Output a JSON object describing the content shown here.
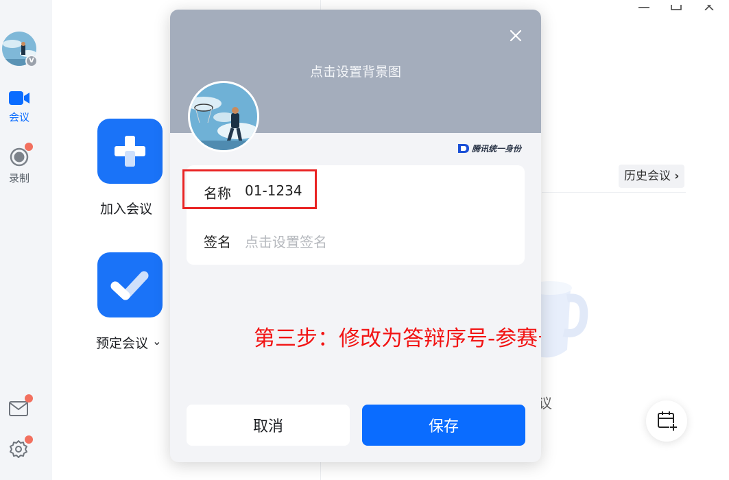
{
  "sidebar": {
    "avatar_badge": "V",
    "items": [
      {
        "label": "会议",
        "icon": "video-camera-icon",
        "active": true
      },
      {
        "label": "录制",
        "icon": "record-icon",
        "active": false
      }
    ],
    "bottom_icons": [
      "mail-icon",
      "gear-icon"
    ]
  },
  "main": {
    "join_label": "加入会议",
    "schedule_label": "预定会议",
    "dropdown_glyph": "⌄"
  },
  "right": {
    "history_label": "历史会议",
    "history_chevron": "›",
    "empty_partial": "议"
  },
  "dialog": {
    "set_background": "点击设置背景图",
    "tencent_id": "腾讯统一身份",
    "name_label": "名称",
    "name_value": "01-1234",
    "signature_label": "签名",
    "signature_placeholder": "点击设置签名",
    "cancel_label": "取消",
    "save_label": "保存",
    "annotation": "第三步：修改为答辩序号-参赛号"
  },
  "colors": {
    "accent": "#0a6cff",
    "header_gray": "#a4adbc",
    "annotation_red": "#f21414",
    "notification_dot": "#f2705f"
  }
}
